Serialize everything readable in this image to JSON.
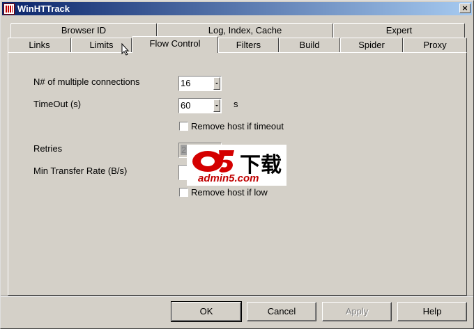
{
  "window": {
    "title": "WinHTTrack"
  },
  "tabs": {
    "row1": [
      {
        "label": "Browser ID"
      },
      {
        "label": "Log, Index, Cache"
      },
      {
        "label": "Expert"
      }
    ],
    "row2": [
      {
        "label": "Links"
      },
      {
        "label": "Limits"
      },
      {
        "label": "Flow Control",
        "active": true
      },
      {
        "label": "Filters"
      },
      {
        "label": "Build"
      },
      {
        "label": "Spider"
      },
      {
        "label": "Proxy"
      }
    ]
  },
  "form": {
    "connections_label": "N# of multiple connections",
    "connections_value": "16",
    "timeout_label": "TimeOut (s)",
    "timeout_value": "60",
    "timeout_unit": "s",
    "remove_timeout_label": "Remove host if timeout",
    "retries_label": "Retries",
    "retries_value": "2",
    "min_rate_label": "Min Transfer Rate (B/s)",
    "min_rate_value": "",
    "remove_low_label": "Remove host if low"
  },
  "watermark": {
    "chars": "下载",
    "domain": "admin5.com"
  },
  "buttons": {
    "ok": "OK",
    "cancel": "Cancel",
    "apply": "Apply",
    "help": "Help"
  }
}
